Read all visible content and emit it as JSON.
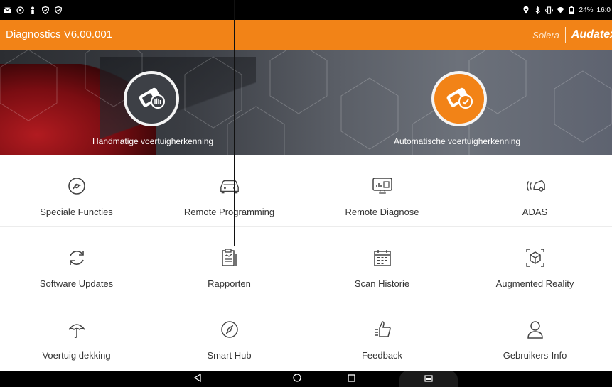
{
  "status_bar": {
    "left_icons": [
      "mail-icon",
      "settings-icon",
      "person-icon",
      "shield-icon",
      "shield-icon"
    ],
    "right_icons": [
      "location-icon",
      "bluetooth-icon",
      "vibrate-icon",
      "wifi-icon",
      "battery-icon"
    ],
    "battery": "24%",
    "time": "16:0"
  },
  "app_bar": {
    "title": "Diagnostics V6.00.001",
    "brand_solera": "Solera",
    "brand_audatex": "Audatex",
    "color": "#f28317"
  },
  "hero": {
    "manual_label": "Handmatige voertuigherkenning",
    "auto_label": "Automatische voertuigherkenning",
    "manual_icon": "manual-vin-icon",
    "auto_icon": "auto-vin-icon"
  },
  "grid": {
    "rows": [
      [
        {
          "label": "Speciale Functies",
          "icon": "special-functions-icon"
        },
        {
          "label": "Remote Programming",
          "icon": "car-icon"
        },
        {
          "label": "Remote Diagnose",
          "icon": "monitor-icon"
        },
        {
          "label": "ADAS",
          "icon": "adas-icon"
        }
      ],
      [
        {
          "label": "Software Updates",
          "icon": "refresh-icon"
        },
        {
          "label": "Rapporten",
          "icon": "report-icon"
        },
        {
          "label": "Scan Historie",
          "icon": "calendar-icon"
        },
        {
          "label": "Augmented Reality",
          "icon": "cube-icon"
        }
      ],
      [
        {
          "label": "Voertuig dekking",
          "icon": "umbrella-icon"
        },
        {
          "label": "Smart Hub",
          "icon": "compass-icon"
        },
        {
          "label": "Feedback",
          "icon": "thumbs-up-icon"
        },
        {
          "label": "Gebruikers-Info",
          "icon": "user-icon"
        }
      ]
    ]
  },
  "nav_bar": {
    "buttons": [
      "back-icon",
      "home-icon",
      "recent-apps-icon",
      "keyboard-icon"
    ]
  }
}
